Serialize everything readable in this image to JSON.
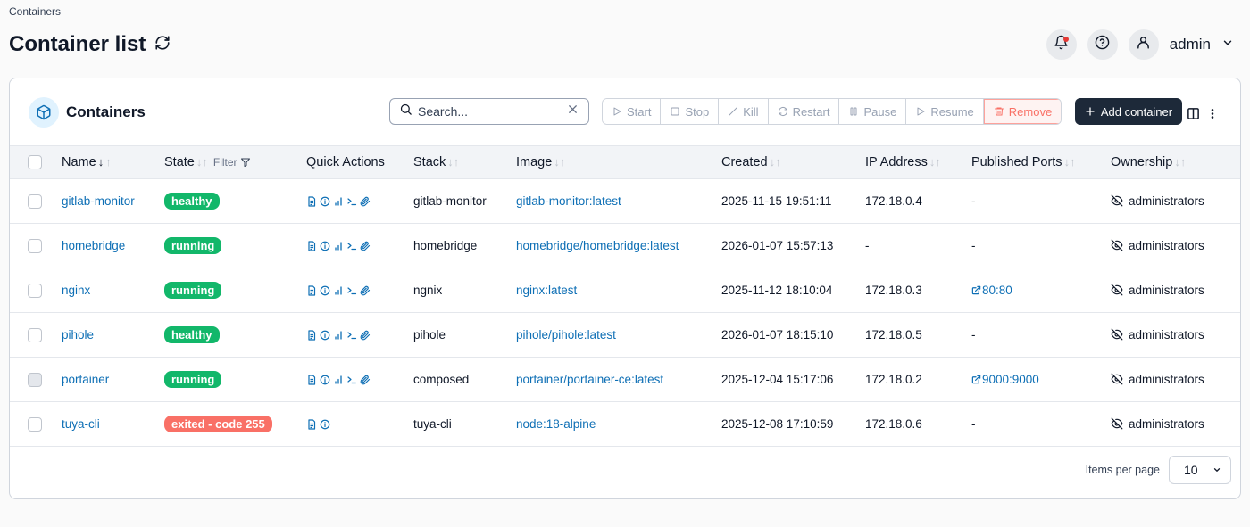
{
  "breadcrumb": "Containers",
  "page": {
    "title": "Container list"
  },
  "header": {
    "user": "admin"
  },
  "card": {
    "title": "Containers"
  },
  "search": {
    "placeholder": "Search..."
  },
  "actions": {
    "start": "Start",
    "stop": "Stop",
    "kill": "Kill",
    "restart": "Restart",
    "pause": "Pause",
    "resume": "Resume",
    "remove": "Remove",
    "add": "Add container"
  },
  "columns": {
    "name": "Name",
    "state": "State",
    "filter": "Filter",
    "quick": "Quick Actions",
    "stack": "Stack",
    "image": "Image",
    "created": "Created",
    "ip": "IP Address",
    "ports": "Published Ports",
    "ownership": "Ownership"
  },
  "rows": [
    {
      "name": "gitlab-monitor",
      "state": "healthy",
      "stack": "gitlab-monitor",
      "image": "gitlab-monitor:latest",
      "created": "2025-11-15 19:51:11",
      "ip": "172.18.0.4",
      "ports": "-",
      "ownership": "administrators"
    },
    {
      "name": "homebridge",
      "state": "running",
      "stack": "homebridge",
      "image": "homebridge/homebridge:latest",
      "created": "2026-01-07 15:57:13",
      "ip": "-",
      "ports": "-",
      "ownership": "administrators"
    },
    {
      "name": "nginx",
      "state": "running",
      "stack": "ngnix",
      "image": "nginx:latest",
      "created": "2025-11-12 18:10:04",
      "ip": "172.18.0.3",
      "ports": "80:80",
      "ownership": "administrators"
    },
    {
      "name": "pihole",
      "state": "healthy",
      "stack": "pihole",
      "image": "pihole/pihole:latest",
      "created": "2026-01-07 18:15:10",
      "ip": "172.18.0.5",
      "ports": "-",
      "ownership": "administrators"
    },
    {
      "name": "portainer",
      "state": "running",
      "stack": "composed",
      "image": "portainer/portainer-ce:latest",
      "created": "2025-12-04 15:17:06",
      "ip": "172.18.0.2",
      "ports": "9000:9000",
      "ownership": "administrators"
    },
    {
      "name": "tuya-cli",
      "state": "exited - code 255",
      "stack": "tuya-cli",
      "image": "node:18-alpine",
      "created": "2025-12-08 17:10:59",
      "ip": "172.18.0.6",
      "ports": "-",
      "ownership": "administrators"
    }
  ],
  "pagination": {
    "label": "Items per page",
    "value": "10"
  },
  "colors": {
    "accent": "#0e6fb5",
    "success": "#12b76a",
    "danger": "#f97066",
    "dark": "#1d2939"
  }
}
